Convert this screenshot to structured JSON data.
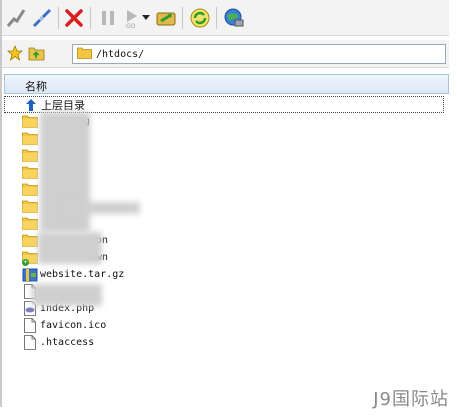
{
  "toolbar": {
    "icons": [
      "connect-icon",
      "disconnect-icon",
      "abort-icon",
      "pause-icon",
      "play-icon",
      "dropdown-icon",
      "transfer-icon",
      "refresh-icon",
      "globe-icon"
    ]
  },
  "address_bar": {
    "path": "/htdocs/"
  },
  "list": {
    "column_header": "名称",
    "parent_label": "上层目录",
    "items": [
      {
        "type": "folder",
        "label": "g"
      },
      {
        "type": "folder",
        "label": ""
      },
      {
        "type": "folder",
        "label": ""
      },
      {
        "type": "folder",
        "label": ""
      },
      {
        "type": "folder",
        "label": ""
      },
      {
        "type": "folder",
        "label": ""
      },
      {
        "type": "folder",
        "label": ""
      },
      {
        "type": "folder",
        "label": "ion"
      },
      {
        "type": "folder",
        "label": "own"
      },
      {
        "type": "archive",
        "label": "website.tar.gz"
      },
      {
        "type": "file",
        "label": ""
      },
      {
        "type": "php",
        "label": "index.php"
      },
      {
        "type": "file",
        "label": "favicon.ico"
      },
      {
        "type": "file",
        "label": ".htaccess"
      }
    ]
  },
  "watermark": "J9国际站",
  "colors": {
    "folder": "#f4c542",
    "accent_blue": "#1f5fbf",
    "abort_red": "#d81e1e",
    "refresh_green": "#2e9b2e"
  }
}
